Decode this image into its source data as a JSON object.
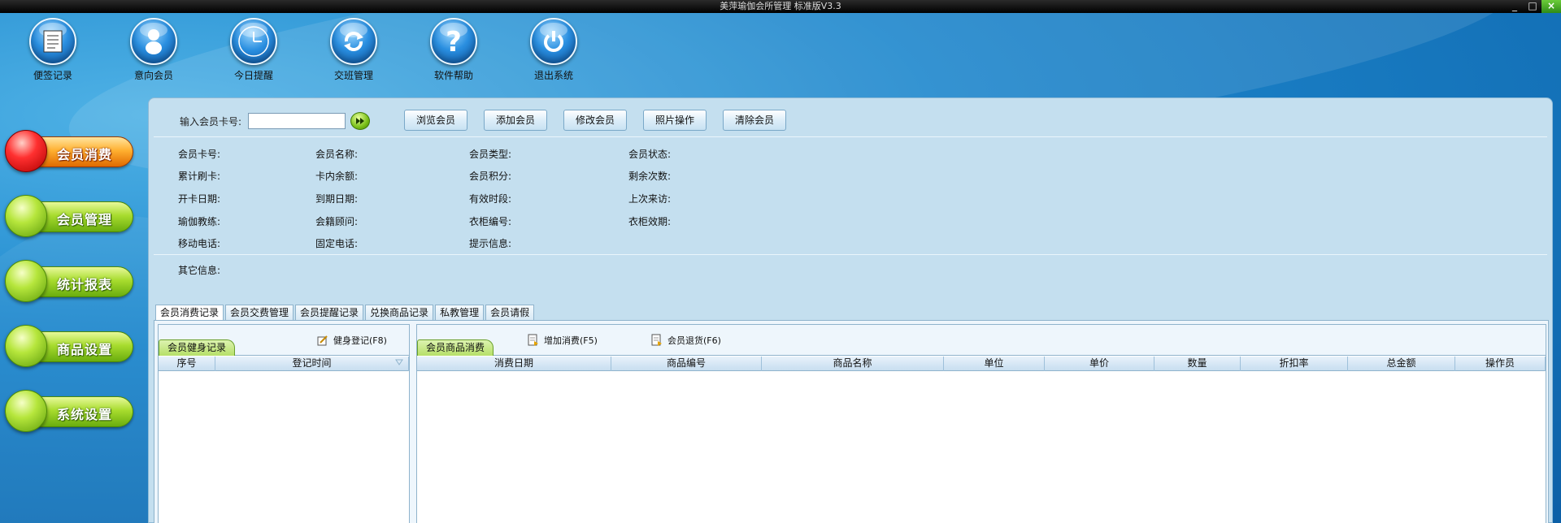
{
  "window": {
    "title": "美萍瑜伽会所管理 标准版V3.3",
    "controls": [
      "_",
      "□",
      "×"
    ]
  },
  "toolbar": [
    {
      "label": "便签记录",
      "icon": "notepad-icon"
    },
    {
      "label": "意向会员",
      "icon": "person-icon"
    },
    {
      "label": "今日提醒",
      "icon": "clock-icon"
    },
    {
      "label": "交班管理",
      "icon": "refresh-icon"
    },
    {
      "label": "软件帮助",
      "icon": "help-icon"
    },
    {
      "label": "退出系统",
      "icon": "power-icon"
    }
  ],
  "leftnav": [
    {
      "label": "会员消费",
      "active": true
    },
    {
      "label": "会员管理",
      "active": false
    },
    {
      "label": "统计报表",
      "active": false
    },
    {
      "label": "商品设置",
      "active": false
    },
    {
      "label": "系统设置",
      "active": false
    }
  ],
  "search": {
    "label": "输入会员卡号:",
    "value": "",
    "placeholder": ""
  },
  "actions": [
    "浏览会员",
    "添加会员",
    "修改会员",
    "照片操作",
    "清除会员"
  ],
  "fields": {
    "row1": [
      "会员卡号:",
      "会员名称:",
      "会员类型:",
      "会员状态:"
    ],
    "row2": [
      "累计刷卡:",
      "卡内余额:",
      "会员积分:",
      "剩余次数:"
    ],
    "row3": [
      "开卡日期:",
      "到期日期:",
      "有效时段:",
      "上次来访:"
    ],
    "row4": [
      "瑜伽教练:",
      "会籍顾问:",
      "衣柜编号:",
      "衣柜效期:"
    ],
    "row5": [
      "移动电话:",
      "固定电话:",
      "提示信息:"
    ],
    "other": "其它信息:"
  },
  "tabs": [
    "会员消费记录",
    "会员交费管理",
    "会员提醒记录",
    "兑换商品记录",
    "私教管理",
    "会员请假"
  ],
  "fitness": {
    "tab": "会员健身记录",
    "register": "健身登记(F8)",
    "columns": [
      "序号",
      "登记时间"
    ]
  },
  "consume": {
    "tab": "会员商品消费",
    "add": "增加消费(F5)",
    "refund": "会员退货(F6)",
    "columns": [
      "消费日期",
      "商品编号",
      "商品名称",
      "单位",
      "单价",
      "数量",
      "折扣率",
      "总金额",
      "操作员"
    ]
  },
  "colors": {
    "accent": "#1d86cc",
    "panel": "#c4dfef",
    "nav_green": "#a8dc2e",
    "nav_active": "#ff3030"
  }
}
